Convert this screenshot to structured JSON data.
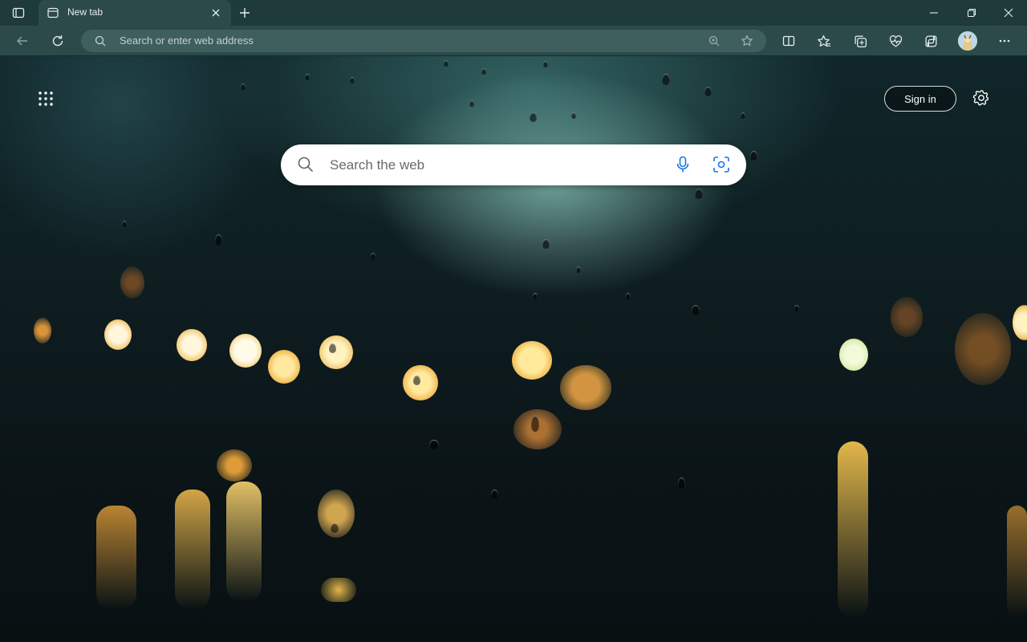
{
  "tab": {
    "title": "New tab"
  },
  "address_bar": {
    "placeholder": "Search or enter web address"
  },
  "page": {
    "search_placeholder": "Search the web",
    "sign_in_label": "Sign in"
  },
  "icons": {
    "tab_actions": "tab-actions-icon",
    "tab_favicon": "new-tab-page-icon",
    "close_tab": "close-icon",
    "new_tab": "plus-icon",
    "minimize": "minimize-icon",
    "restore": "restore-icon",
    "close_window": "close-icon",
    "back": "back-arrow-icon",
    "refresh": "refresh-icon",
    "search": "search-icon",
    "zoom": "zoom-icon",
    "favorite": "star-icon",
    "split_screen": "split-screen-icon",
    "favorites": "favorites-icon",
    "collections": "collections-icon",
    "browser_essentials": "heart-pulse-icon",
    "copilot": "copilot-icon",
    "profile": "avatar",
    "more": "more-icon",
    "app_launcher": "grid-icon",
    "microphone": "microphone-icon",
    "visual_search": "visual-search-icon",
    "settings": "gear-icon"
  },
  "colors": {
    "titlebar": "#1f3a3a",
    "toolbar": "#2b4a49",
    "urlbar": "#3f5f5f",
    "accent_search": "#1a73e8"
  }
}
